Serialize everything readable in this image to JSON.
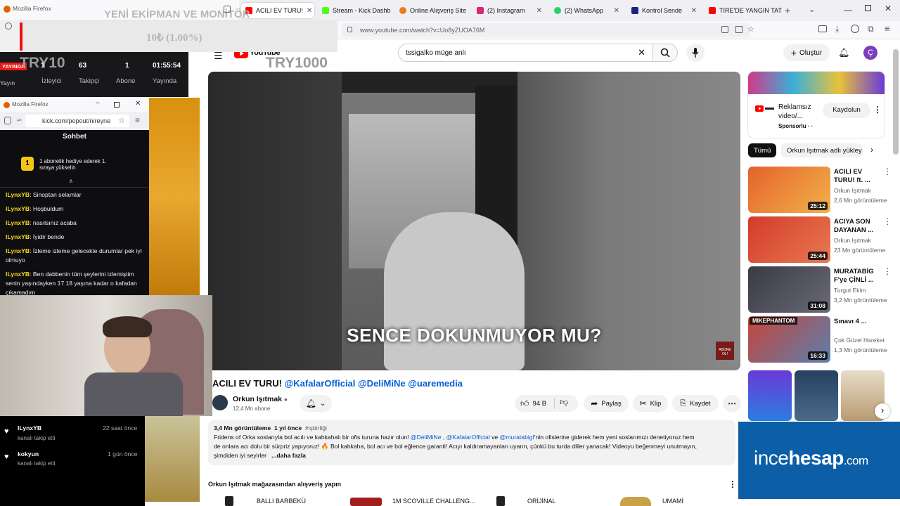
{
  "tabs": [
    {
      "label": "ACILI EV TURU!",
      "color": "#ff0000"
    },
    {
      "label": "Stream - Kick Dashb",
      "color": "#53fc18"
    },
    {
      "label": "Online Alışveriş Site",
      "color": "#f27a1a"
    },
    {
      "label": "(2) Instagram",
      "color": "#d62976"
    },
    {
      "label": "(2) WhatsApp",
      "color": "#25d366"
    },
    {
      "label": "Kontrol Sende",
      "color": "#1a237e"
    },
    {
      "label": "TIRE'DE YANGIN TAT",
      "color": "#ff0000"
    }
  ],
  "url": "www.youtube.com/watch?v=Uo8yZUOA76M",
  "search": {
    "query": "tssigalko müge anlı"
  },
  "create_label": "Oluştur",
  "youtube_logo": "YouTube",
  "video": {
    "subtitle": "SENCE DOKUNMUYOR MU?",
    "corner": "ABONE OL!",
    "title_main": "ACILI EV TURU!",
    "title_tags": "@KafalarOfficial @DeliMiNe @uaremedia"
  },
  "channel": {
    "name": "Orkun Işıtmak",
    "subs": "12,4 Mn abone"
  },
  "actions": {
    "likes": "94 B",
    "share": "Paylaş",
    "clip": "Klip",
    "save": "Kaydet"
  },
  "description": {
    "views": "3,4 Mn görüntüleme",
    "date": "1 yıl önce",
    "hashtag": "#işbirliği",
    "line1_a": "Fridens of Orka soslarıyla bol acılı ve kahkahalı bir ofis turuna hazır olun! ",
    "line1_t1": "@DeliMiNe",
    "line1_b": " , ",
    "line1_t2": "@KafalarOfficial",
    "line1_c": " ve ",
    "line1_t3": "@muratabigf",
    "line1_d": "'nin ofislerine giderek hem yeni soslarımızı denetiyoruz hem",
    "line2": "de onlara acı dolu bir sürpriz yapıyoruz! 🔥 Bol kahkaha, bol acı ve bol eğlence garanti! Acıyı kaldıramayanları uyarın, çünkü bu turda diller yanacak! Videoyu beğenmeyi unutmayın,",
    "line3": "şimdiden iyi seyirler",
    "more": "...daha fazla"
  },
  "store": {
    "title": "Orkun Işıtmak mağazasından alışveriş yapın",
    "items": [
      "BALLI BARBEKÜ",
      "1M SCOVILLE CHALLENG...",
      "ORİJİNAL",
      "UMAMİ"
    ]
  },
  "ad": {
    "title": "Reklamsız video/...",
    "sponsor": "Sponsorlu · ·",
    "button": "Kaydolun"
  },
  "chips": {
    "all": "Tümü",
    "channel": "Orkun Işıtmak adlı yükley"
  },
  "recommendations": [
    {
      "title": "ACILI EV TURU! ft. ...",
      "channel": "Orkun Işıtmak",
      "views": "2,6 Mn görüntüleme",
      "duration": "25:12",
      "thumb": "#e3632d"
    },
    {
      "title": "ACIYA SON DAYANAN ...",
      "channel": "Orkun Işıtmak",
      "views": "23 Mn görüntüleme",
      "duration": "25:44",
      "thumb": "#d43a2a"
    },
    {
      "title": "MURATABİG F'ye ÇİNLİ ...",
      "channel": "Turgut Ekim",
      "views": "3,2 Mn görüntüleme",
      "duration": "31:08",
      "thumb": "#3a3a44"
    },
    {
      "title": "Sınavı 4 ...",
      "channel": "Çok Güzel Hareket",
      "views": "1,3 Mn görüntüleme",
      "duration": "16:33",
      "thumb": "#c6453a"
    }
  ],
  "overlay": {
    "browser": "Mozilla Firefox",
    "goal_title": "YENİ EKİPMAN VE MONİTÖR",
    "goal_value": "10₺ (1.00%)",
    "try_small": "TRY10",
    "try_big": "TRY1000",
    "live": "YAYINDA",
    "stats_values": [
      "1",
      "63",
      "1",
      "01:55:54"
    ],
    "stats_labels": [
      "İzleyici",
      "Takipçi",
      "Abone",
      "Yayında"
    ],
    "yayin": "Yayın",
    "chat_url": "kick.com/popout/nireyne",
    "chat_title": "Sohbet",
    "chat_gift_num": "1",
    "chat_gift": "1 abonelik hediye ederek 1. sıraya yükselin",
    "messages": [
      {
        "user": "lLynxYB",
        "text": "Sinoptan selamlar"
      },
      {
        "user": "lLynxYB",
        "text": "Hoşbuldum"
      },
      {
        "user": "lLynxYB",
        "text": "nasılsınız acaba"
      },
      {
        "user": "lLynxYB",
        "text": "İyidir bende"
      },
      {
        "user": "lLynxYB",
        "text": "İzleme izleme gelecekte durumlar pek iyi olmuyo"
      },
      {
        "user": "lLynxYB",
        "text": "Ben dabbenin tüm şeylerini izlemiştim senin yaşındayken 17 18 yaşına kadar o kafadan çıkamadım"
      }
    ],
    "followers": [
      {
        "name": "lLynxYB",
        "action": "kanalı takip etti",
        "time": "22 saat önce"
      },
      {
        "name": "kokyun",
        "action": "kanalı takip etti",
        "time": "1 gün önce"
      }
    ],
    "mikephantom": "MIKEPHANTOM",
    "brand_a": "ince",
    "brand_b": "hesap",
    "brand_c": ".com"
  },
  "colors": {
    "youtube_red": "#ff0000",
    "kick_green": "#53fc18",
    "link_blue": "#065fd4",
    "incehesap_blue": "#0c5ea7"
  }
}
